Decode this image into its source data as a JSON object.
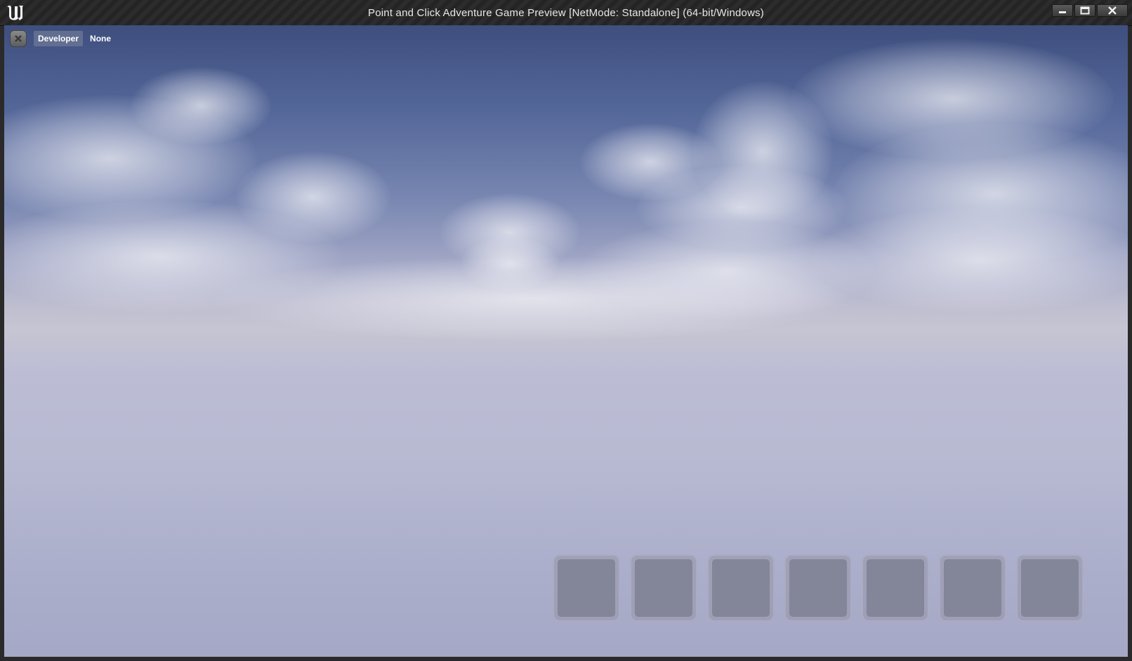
{
  "window": {
    "title": "Point and Click Adventure Game Preview [NetMode: Standalone] (64-bit/Windows)",
    "controls": {
      "minimize_icon": "minimize-icon",
      "maximize_icon": "maximize-icon",
      "close_icon": "close-icon"
    }
  },
  "dev_bar": {
    "close_icon": "close-icon",
    "label": "Developer",
    "value": "None"
  },
  "inventory": {
    "slots": 7
  },
  "colors": {
    "title_text": "#e8e8e8",
    "sky_top": "#3e4f7e",
    "horizon": "#c6c5d3",
    "ground": "#a5a8c6"
  }
}
